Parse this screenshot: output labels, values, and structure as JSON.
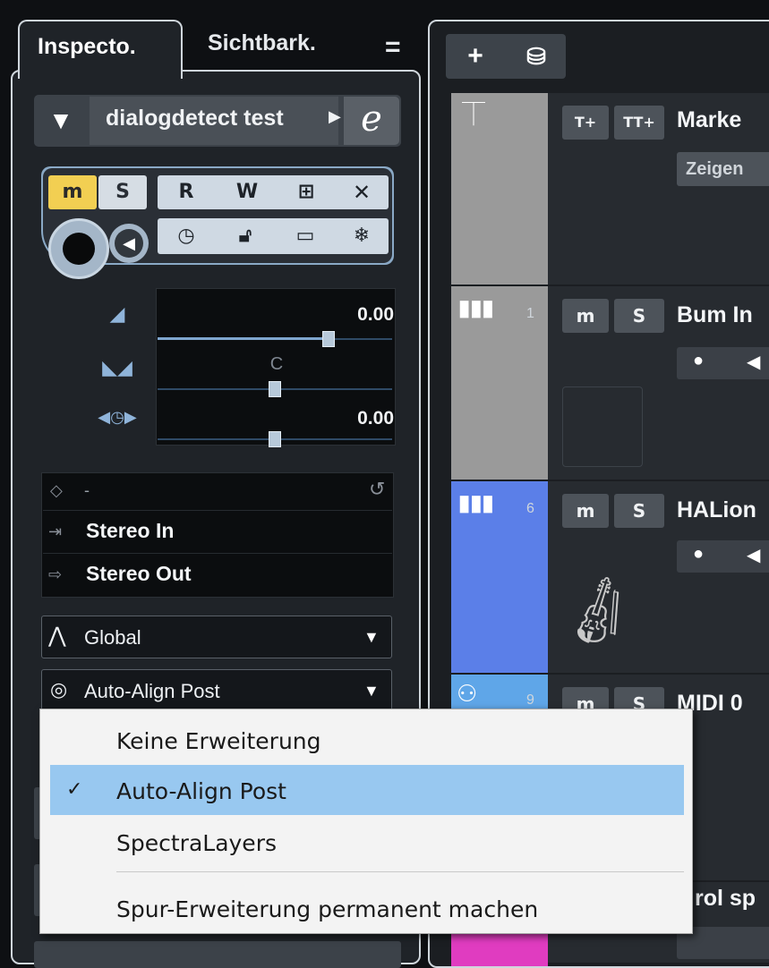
{
  "inspector": {
    "tabs": [
      {
        "label": "Inspecto."
      },
      {
        "label": "Sichtbark."
      }
    ],
    "menu_glyph": "=",
    "track_title": "dialogdetect test",
    "edit_glyph": "e",
    "buttons": {
      "mute": "m",
      "solo": "S",
      "read": "R",
      "write": "W"
    },
    "fader": {
      "volume_value": "0.00",
      "pan_value": "C",
      "delay_value": "0.00",
      "volume_level": 0.73,
      "pan_level": 0.5,
      "delay_level": 0.5
    },
    "routing": {
      "preset": "-",
      "input": "Stereo In",
      "output": "Stereo Out"
    },
    "automation_dropdown": "Global",
    "extension_dropdown": "Auto-Align Post"
  },
  "project": {
    "toolbar": {
      "add": "+",
      "folder": "folder-icon"
    },
    "tracks": [
      {
        "number": "",
        "name": "Marke",
        "show_label": "Zeigen",
        "color": "#9a9a9a",
        "buttons": [
          "T+",
          "TT+"
        ]
      },
      {
        "number": "1",
        "name": "Bum In",
        "color": "#9a9a9a",
        "buttons": [
          "m",
          "S"
        ]
      },
      {
        "number": "6",
        "name": "HALion",
        "color": "#5b7fe8",
        "buttons": [
          "m",
          "S"
        ]
      },
      {
        "number": "9",
        "name": "MIDI 0",
        "color": "#5fa6e8",
        "buttons": [
          "m",
          "S"
        ]
      },
      {
        "number": "",
        "name": "rol sp",
        "color": "#e03cc0",
        "buttons": []
      }
    ]
  },
  "context_menu": {
    "items": [
      {
        "label": "Keine Erweiterung",
        "checked": false
      },
      {
        "label": "Auto-Align Post",
        "checked": true
      },
      {
        "label": "SpectraLayers",
        "checked": false
      },
      {
        "label": "Spur-Erweiterung permanent machen",
        "checked": false
      }
    ],
    "check_glyph": "✓"
  },
  "colors": {
    "mute_active": "#f2cf52",
    "highlight": "#98c8f0",
    "accent_blue": "#8aa9c6"
  }
}
